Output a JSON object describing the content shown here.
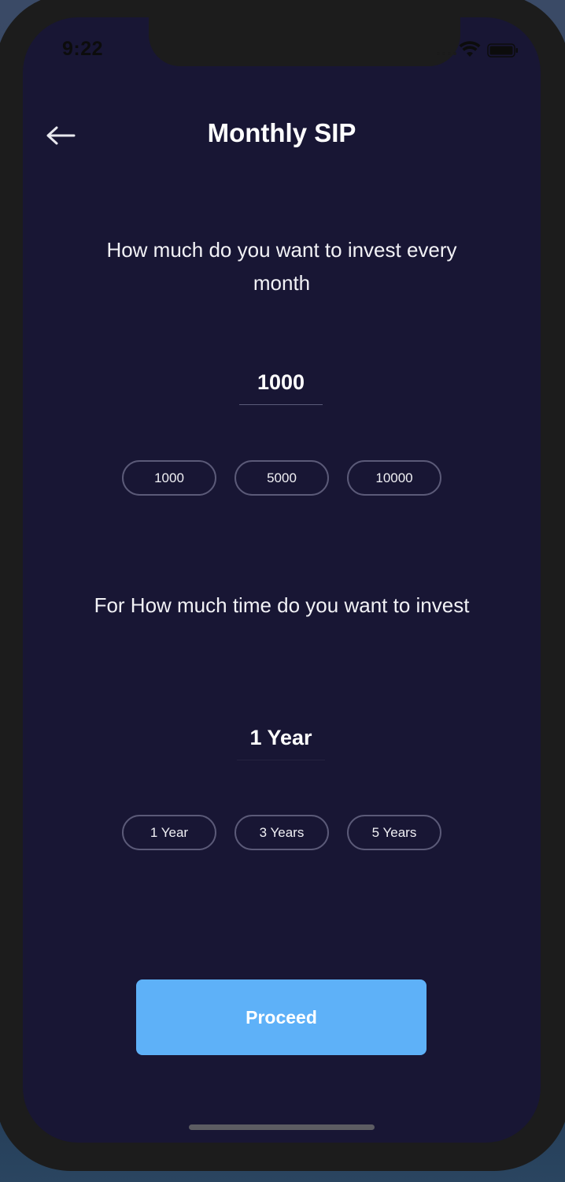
{
  "status_bar": {
    "time": "9:22"
  },
  "header": {
    "title": "Monthly SIP",
    "back_icon": "arrow-left-icon"
  },
  "amount_section": {
    "question": "How much do you want to invest every month",
    "value": "1000",
    "options": [
      "1000",
      "5000",
      "10000"
    ]
  },
  "duration_section": {
    "question": "For How much time do you want to invest",
    "value": "1 Year",
    "options": [
      "1 Year",
      "3 Years",
      "5 Years"
    ]
  },
  "footer": {
    "proceed_label": "Proceed"
  },
  "colors": {
    "background": "#181634",
    "accent": "#5eb1f8",
    "chip_border": "#5b5a78",
    "text": "#ffffff"
  }
}
